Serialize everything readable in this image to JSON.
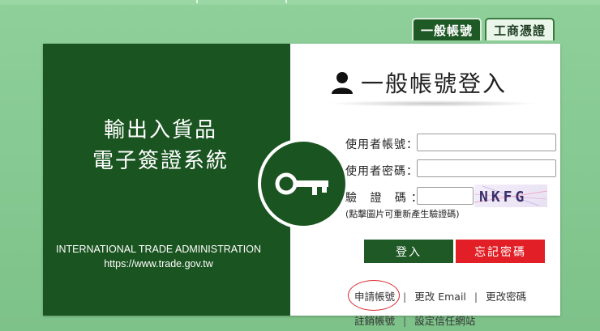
{
  "tabs": [
    {
      "label": "一般帳號",
      "active": true
    },
    {
      "label": "工商憑證",
      "active": false
    }
  ],
  "left_panel": {
    "title_line1": "輸出入貨品",
    "title_line2": "電子簽證系統",
    "org_name": "INTERNATIONAL TRADE ADMINISTRATION",
    "org_url": "https://www.trade.gov.tw",
    "icon": "key-icon"
  },
  "login": {
    "heading": "一般帳號登入",
    "heading_icon": "user-icon",
    "username_label": "使用者帳號：",
    "username_value": "",
    "password_label": "使用者密碼：",
    "password_value": "",
    "captcha_label": "驗 證 碼：",
    "captcha_value": "",
    "captcha_text": "NKFG",
    "captcha_hint": "(點擊圖片可重新產生驗證碼)",
    "login_button": "登入",
    "forgot_button": "忘記密碼"
  },
  "links": {
    "row1": [
      "申請帳號",
      "更改 Email",
      "更改密碼"
    ],
    "row2": [
      "註銷帳號",
      "設定信任網站"
    ],
    "separator": "|"
  },
  "colors": {
    "brand_green": "#1a5420",
    "button_green": "#1f5a26",
    "button_red": "#e21f26",
    "background_green": "#86c992",
    "highlight_ring": "#d8272e"
  }
}
